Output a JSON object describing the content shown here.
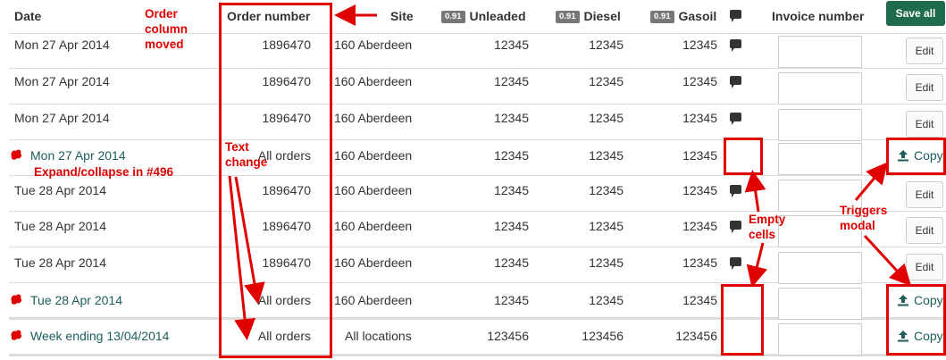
{
  "headers": {
    "date": "Date",
    "order_number": "Order number",
    "site": "Site",
    "unleaded": "Unleaded",
    "diesel": "Diesel",
    "gasoil": "Gasoil",
    "invoice_number": "Invoice number",
    "badge": "0.91",
    "save_all": "Save all"
  },
  "rows": [
    {
      "date": "Mon 27 Apr 2014",
      "order": "1896470",
      "site": "160 Aberdeen",
      "unleaded": "12345",
      "diesel": "12345",
      "gasoil": "12345",
      "action": "Edit"
    },
    {
      "date": "Mon 27 Apr 2014",
      "order": "1896470",
      "site": "160 Aberdeen",
      "unleaded": "12345",
      "diesel": "12345",
      "gasoil": "12345",
      "action": "Edit"
    },
    {
      "date": "Mon 27 Apr 2014",
      "order": "1896470",
      "site": "160 Aberdeen",
      "unleaded": "12345",
      "diesel": "12345",
      "gasoil": "12345",
      "action": "Edit"
    },
    {
      "date": "Mon 27 Apr 2014",
      "order": "All orders",
      "site": "160 Aberdeen",
      "unleaded": "12345",
      "diesel": "12345",
      "gasoil": "12345",
      "action": "Copy"
    },
    {
      "date": "Tue 28 Apr 2014",
      "order": "1896470",
      "site": "160 Aberdeen",
      "unleaded": "12345",
      "diesel": "12345",
      "gasoil": "12345",
      "action": "Edit"
    },
    {
      "date": "Tue 28 Apr 2014",
      "order": "1896470",
      "site": "160 Aberdeen",
      "unleaded": "12345",
      "diesel": "12345",
      "gasoil": "12345",
      "action": "Edit"
    },
    {
      "date": "Tue 28 Apr 2014",
      "order": "1896470",
      "site": "160 Aberdeen",
      "unleaded": "12345",
      "diesel": "12345",
      "gasoil": "12345",
      "action": "Edit"
    },
    {
      "date": "Tue 28 Apr 2014",
      "order": "All orders",
      "site": "160 Aberdeen",
      "unleaded": "12345",
      "diesel": "12345",
      "gasoil": "12345",
      "action": "Copy"
    },
    {
      "date": "Week ending 13/04/2014",
      "order": "All orders",
      "site": "All locations",
      "unleaded": "123456",
      "diesel": "123456",
      "gasoil": "123456",
      "action": "Copy"
    }
  ],
  "annotations": {
    "order_moved": [
      "Order",
      "column",
      "moved"
    ],
    "text_change": [
      "Text",
      "change"
    ],
    "expand_collapse": "Expand/collapse in #496",
    "empty_cells": [
      "Empty",
      "cells"
    ],
    "triggers_modal": [
      "Triggers",
      "modal"
    ]
  },
  "colors": {
    "link": "#1b5e5a",
    "save_button": "#1f6b4e",
    "annotation": "#e00000",
    "badge": "#777777"
  }
}
